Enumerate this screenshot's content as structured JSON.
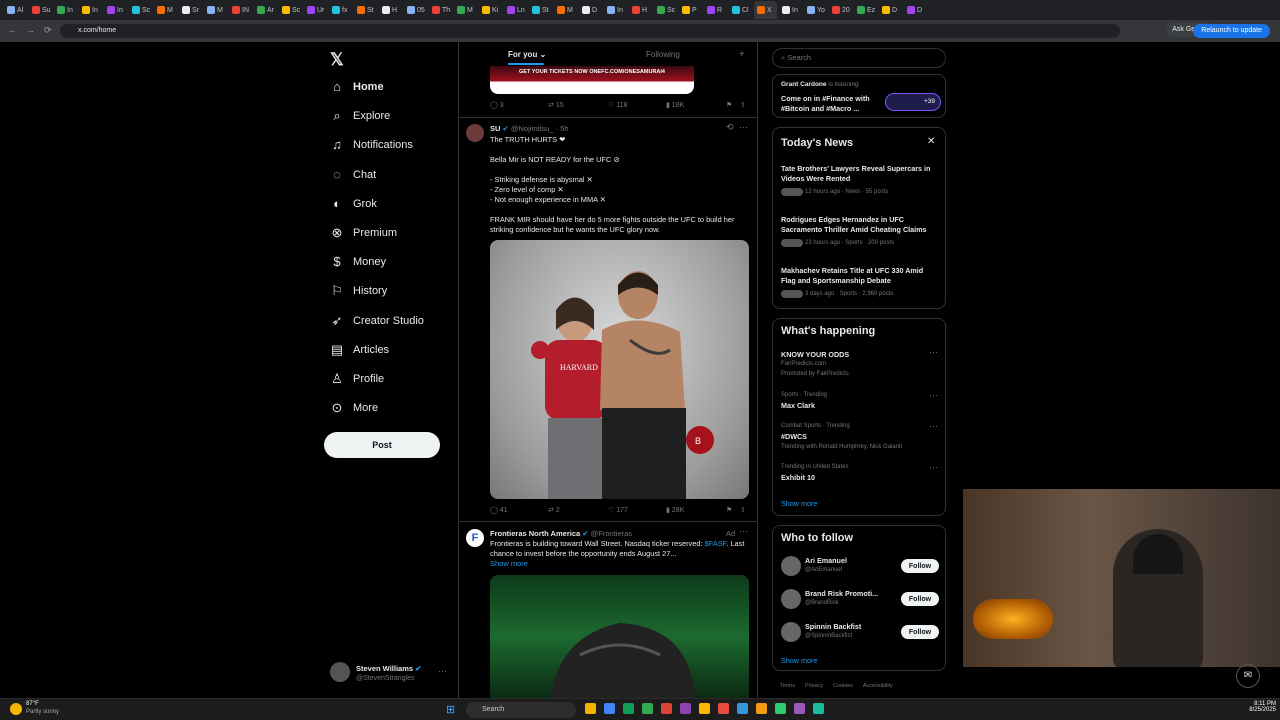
{
  "browser": {
    "tabs": [
      "Al",
      "Su",
      "In",
      "In",
      "In",
      "Sc",
      "M",
      "Sr",
      "M",
      "IN",
      "Ar",
      "Sc",
      "Ur",
      "fx",
      "St",
      "H",
      "05",
      "Th",
      "M",
      "Ki",
      "Ln",
      "St",
      "M",
      "D",
      "In",
      "H",
      "Sc",
      "P",
      "R",
      "Cl",
      "X",
      "In",
      "Yo",
      "20",
      "Ez",
      "D",
      "D"
    ],
    "active_tab_index": 30,
    "url": "x.com/home",
    "ask_gemini": "Ask Gemini",
    "relaunch": "Relaunch to update"
  },
  "nav": {
    "items": [
      {
        "label": "Home",
        "icon": "home-icon"
      },
      {
        "label": "Explore",
        "icon": "search-icon"
      },
      {
        "label": "Notifications",
        "icon": "bell-icon"
      },
      {
        "label": "Chat",
        "icon": "chat-icon"
      },
      {
        "label": "Grok",
        "icon": "grok-icon"
      },
      {
        "label": "Premium",
        "icon": "premium-icon"
      },
      {
        "label": "Money",
        "icon": "money-icon"
      },
      {
        "label": "History",
        "icon": "bookmark-icon"
      },
      {
        "label": "Creator Studio",
        "icon": "rocket-icon"
      },
      {
        "label": "Articles",
        "icon": "articles-icon"
      },
      {
        "label": "Profile",
        "icon": "profile-icon"
      },
      {
        "label": "More",
        "icon": "more-icon"
      }
    ],
    "post": "Post",
    "user": {
      "name": "Steven Williams",
      "handle": "@StevenStrangles"
    }
  },
  "feed": {
    "tabs": {
      "for_you": "For you",
      "following": "Following"
    },
    "ad_banner": "GET YOUR TICKETS NOW  ONEFC.COM/ONESAMURAI4",
    "prev_stats": {
      "replies": "3",
      "reposts": "15",
      "likes": "118",
      "views": "18K"
    },
    "post1": {
      "name": "SU",
      "handle": "@Nojimitsu_",
      "time": "· 5h",
      "line1": "The TRUTH HURTS ❤",
      "line2": "Bella Mir is NOT READY for the UFC ⊘",
      "bullet1": "- Striking defense is abysmal ✕",
      "bullet2": "- Zero level of comp ✕",
      "bullet3": "- Not enough experience in MMA ✕",
      "line3": "FRANK MIR should have her do 5 more fights outside the UFC to build her striking confidence but he wants the UFC glory now.",
      "stats": {
        "replies": "41",
        "reposts": "2",
        "likes": "177",
        "views": "28K"
      }
    },
    "post2": {
      "name": "Frontieras North America",
      "handle": "@Frontieras",
      "ad": "Ad",
      "text_a": "Frontieras is building toward Wall Street. Nasdaq ticker reserved: ",
      "cashtag": "$FASF",
      "text_b": ". Last chance to invest before the opportunity ends August 27...",
      "show_more": "Show more"
    }
  },
  "right": {
    "search_placeholder": "Search",
    "space": {
      "host": "Grant Cardone",
      "status": "is listening",
      "title": "Come on in #Finance with #Bitcoin and #Macro ...",
      "count": "+39"
    },
    "news": {
      "title": "Today's News",
      "items": [
        {
          "title": "Tate Brothers' Lawyers Reveal Supercars in Videos Were Rented",
          "meta": "12 hours ago · News · 55 posts"
        },
        {
          "title": "Rodrigues Edges Hernandez in UFC Sacramento Thriller Amid Cheating Claims",
          "meta": "23 hours ago · Sports · 200 posts"
        },
        {
          "title": "Makhachev Retains Title at UFC 330 Amid Flag and Sportsmanship Debate",
          "meta": "3 days ago · Sports · 2,960 posts"
        }
      ]
    },
    "happening": {
      "title": "What's happening",
      "items": [
        {
          "top": "",
          "title": "KNOW YOUR ODDS",
          "line1": "FairPredicts.com",
          "line2": "Promoted by FairPredicts"
        },
        {
          "top": "Sports · Trending",
          "title": "Max Clark",
          "line1": "",
          "line2": ""
        },
        {
          "top": "Combat Sports · Trending",
          "title": "#DWCS",
          "line1": "Trending with Ronald Humphrey, Nick Galanti",
          "line2": ""
        },
        {
          "top": "Trending in United States",
          "title": "Exhibit 10",
          "line1": "",
          "line2": ""
        }
      ],
      "show_more": "Show more"
    },
    "who": {
      "title": "Who to follow",
      "items": [
        {
          "name": "Ari Emanuel",
          "handle": "@AriEmanuel"
        },
        {
          "name": "Brand Risk Promoti...",
          "handle": "@BrandRisk"
        },
        {
          "name": "Spinnin Backfist",
          "handle": "@SpinninBackfist"
        }
      ],
      "follow": "Follow",
      "show_more": "Show more"
    },
    "footer": [
      "Terms",
      "Privacy",
      "Cookies",
      "Accessibility"
    ]
  },
  "taskbar": {
    "weather_temp": "87°F",
    "weather_desc": "Partly sunny",
    "search": "Search",
    "time": "8:11 PM",
    "date": "8/25/2025"
  }
}
